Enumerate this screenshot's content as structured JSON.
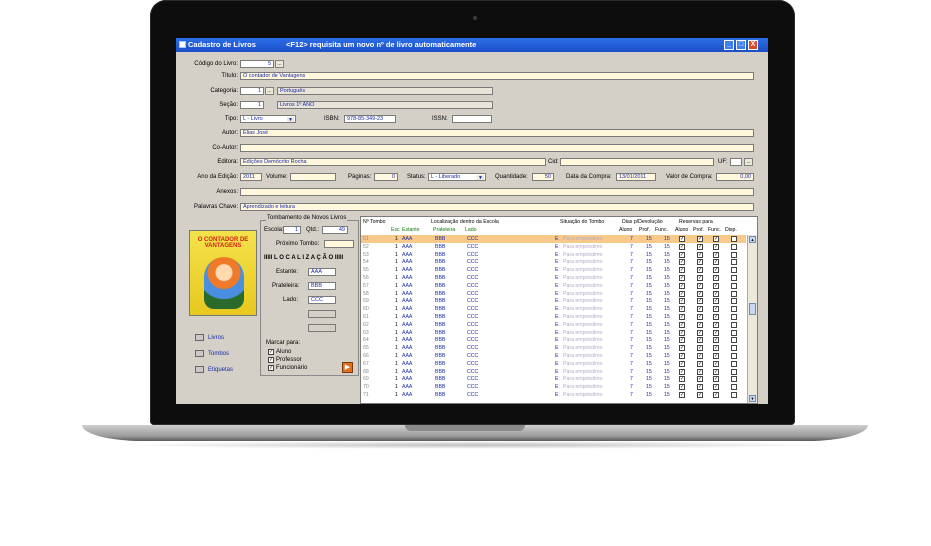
{
  "window": {
    "title": "Cadastro de Livros",
    "subtitle": "<F12> requisita um novo nº de livro automaticamente",
    "min": "_",
    "max": "□",
    "close": "X"
  },
  "form": {
    "codigo_label": "Código do Livro:",
    "codigo_value": "5",
    "codigo_btn": "...",
    "titulo_label": "Título:",
    "titulo_value": "O contador de Vantagens",
    "categoria_label": "Categoria:",
    "categoria_num": "1",
    "categoria_btn": "...",
    "categoria_value": "Português",
    "secao_label": "Seção:",
    "secao_num": "1",
    "secao_value": "Livros 1º ANO",
    "tipo_label": "Tipo:",
    "tipo_value": "L - Livro",
    "isbn_label": "ISBN:",
    "isbn_value": "978-85-349-23",
    "issn_label": "ISSN:",
    "issn_value": "",
    "autor_label": "Autor:",
    "autor_value": "Elias José",
    "coautor_label": "Co-Autor:",
    "coautor_value": "",
    "editora_label": "Editora:",
    "editora_value": "Edições Demócrito Rocha",
    "cid_label": "Cid:",
    "cid_value": "",
    "uf_label": "UF:",
    "uf_value": "",
    "uf_btn": "...",
    "ano_label": "Ano da Edição:",
    "ano_value": "2011",
    "volume_label": "Volume:",
    "volume_value": "",
    "paginas_label": "Páginas:",
    "paginas_value": "0",
    "status_label": "Status:",
    "status_value": "L - Liberado",
    "quantidade_label": "Quantidade:",
    "quantidade_value": "50",
    "data_compra_label": "Data da Compra:",
    "data_compra_value": "13/01/2011",
    "valor_label": "Valor de Compra:",
    "valor_value": "0,00",
    "anexos_label": "Anexos:",
    "anexos_value": "",
    "palavras_label": "Palavras Chave:",
    "palavras_value": "Aprendizado e leitura"
  },
  "cover": {
    "title": "O CONTADOR DE VANTAGENS",
    "author": "Elias José"
  },
  "side_links": [
    "Livros",
    "Tombos",
    "Etiquetas"
  ],
  "tombamento": {
    "title": "Tombamento de Novos Livros",
    "escola_label": "Escola:",
    "escola_value": "1",
    "qtd_label": "Qtd.:",
    "qtd_value": "49",
    "proximo_label": "Próximo Tombo:",
    "proximo_value": "",
    "localizacao_title": "IIIII L O C A L I Z A Ç Ã O IIIII",
    "estante_label": "Estante:",
    "estante_value": "AAA",
    "prateleira_label": "Prateleira:",
    "prateleira_value": "BBB",
    "lado_label": "Lado:",
    "lado_value": "CCC",
    "marcar_title": "Marcar para:",
    "opts": [
      "Aluno",
      "Professor",
      "Funcionário"
    ]
  },
  "grid": {
    "h_tombo": "Nº Tombo",
    "h_loc": "Localização dentro da Escola",
    "h_situacao": "Situação do Tombo",
    "h_dias": "Dias p/Devolução",
    "h_reservas": "Reservas para",
    "sub_esc": "Esc",
    "sub_estante": "Estante",
    "sub_prateleira": "Prateleira",
    "sub_lado": "Lado",
    "sub_aluno": "Aluno",
    "sub_prof": "Prof.",
    "sub_func": "Func.",
    "sub_aluno2": "Aluno",
    "sub_prof2": "Prof.",
    "sub_func2": "Func.",
    "sub_disp": "Disp.",
    "rows": [
      {
        "tombo": "51",
        "esc": "1",
        "estante": "AAA",
        "prat": "BBB",
        "lado": "CCC",
        "sit_code": "E",
        "sit": "Para empréstimo",
        "da": "7",
        "dp": "15",
        "df": "15"
      },
      {
        "tombo": "52",
        "esc": "1",
        "estante": "AAA",
        "prat": "BBB",
        "lado": "CCC",
        "sit_code": "E",
        "sit": "Para empréstimo",
        "da": "7",
        "dp": "15",
        "df": "15"
      },
      {
        "tombo": "53",
        "esc": "1",
        "estante": "AAA",
        "prat": "BBB",
        "lado": "CCC",
        "sit_code": "E",
        "sit": "Para empréstimo",
        "da": "7",
        "dp": "15",
        "df": "15"
      },
      {
        "tombo": "54",
        "esc": "1",
        "estante": "AAA",
        "prat": "BBB",
        "lado": "CCC",
        "sit_code": "E",
        "sit": "Para empréstimo",
        "da": "7",
        "dp": "15",
        "df": "15"
      },
      {
        "tombo": "55",
        "esc": "1",
        "estante": "AAA",
        "prat": "BBB",
        "lado": "CCC",
        "sit_code": "E",
        "sit": "Para empréstimo",
        "da": "7",
        "dp": "15",
        "df": "15"
      },
      {
        "tombo": "56",
        "esc": "1",
        "estante": "AAA",
        "prat": "BBB",
        "lado": "CCC",
        "sit_code": "E",
        "sit": "Para empréstimo",
        "da": "7",
        "dp": "15",
        "df": "15"
      },
      {
        "tombo": "57",
        "esc": "1",
        "estante": "AAA",
        "prat": "BBB",
        "lado": "CCC",
        "sit_code": "E",
        "sit": "Para empréstimo",
        "da": "7",
        "dp": "15",
        "df": "15"
      },
      {
        "tombo": "58",
        "esc": "1",
        "estante": "AAA",
        "prat": "BBB",
        "lado": "CCC",
        "sit_code": "E",
        "sit": "Para empréstimo",
        "da": "7",
        "dp": "15",
        "df": "15"
      },
      {
        "tombo": "59",
        "esc": "1",
        "estante": "AAA",
        "prat": "BBB",
        "lado": "CCC",
        "sit_code": "E",
        "sit": "Para empréstimo",
        "da": "7",
        "dp": "15",
        "df": "15"
      },
      {
        "tombo": "60",
        "esc": "1",
        "estante": "AAA",
        "prat": "BBB",
        "lado": "CCC",
        "sit_code": "E",
        "sit": "Para empréstimo",
        "da": "7",
        "dp": "15",
        "df": "15"
      },
      {
        "tombo": "61",
        "esc": "1",
        "estante": "AAA",
        "prat": "BBB",
        "lado": "CCC",
        "sit_code": "E",
        "sit": "Para empréstimo",
        "da": "7",
        "dp": "15",
        "df": "15"
      },
      {
        "tombo": "62",
        "esc": "1",
        "estante": "AAA",
        "prat": "BBB",
        "lado": "CCC",
        "sit_code": "E",
        "sit": "Para empréstimo",
        "da": "7",
        "dp": "15",
        "df": "15"
      },
      {
        "tombo": "63",
        "esc": "1",
        "estante": "AAA",
        "prat": "BBB",
        "lado": "CCC",
        "sit_code": "E",
        "sit": "Para empréstimo",
        "da": "7",
        "dp": "15",
        "df": "15"
      },
      {
        "tombo": "64",
        "esc": "1",
        "estante": "AAA",
        "prat": "BBB",
        "lado": "CCC",
        "sit_code": "E",
        "sit": "Para empréstimo",
        "da": "7",
        "dp": "15",
        "df": "15"
      },
      {
        "tombo": "65",
        "esc": "1",
        "estante": "AAA",
        "prat": "BBB",
        "lado": "CCC",
        "sit_code": "E",
        "sit": "Para empréstimo",
        "da": "7",
        "dp": "15",
        "df": "15"
      },
      {
        "tombo": "66",
        "esc": "1",
        "estante": "AAA",
        "prat": "BBB",
        "lado": "CCC",
        "sit_code": "E",
        "sit": "Para empréstimo",
        "da": "7",
        "dp": "15",
        "df": "15"
      },
      {
        "tombo": "67",
        "esc": "1",
        "estante": "AAA",
        "prat": "BBB",
        "lado": "CCC",
        "sit_code": "E",
        "sit": "Para empréstimo",
        "da": "7",
        "dp": "15",
        "df": "15"
      },
      {
        "tombo": "68",
        "esc": "1",
        "estante": "AAA",
        "prat": "BBB",
        "lado": "CCC",
        "sit_code": "E",
        "sit": "Para empréstimo",
        "da": "7",
        "dp": "15",
        "df": "15"
      },
      {
        "tombo": "69",
        "esc": "1",
        "estante": "AAA",
        "prat": "BBB",
        "lado": "CCC",
        "sit_code": "E",
        "sit": "Para empréstimo",
        "da": "7",
        "dp": "15",
        "df": "15"
      },
      {
        "tombo": "70",
        "esc": "1",
        "estante": "AAA",
        "prat": "BBB",
        "lado": "CCC",
        "sit_code": "E",
        "sit": "Para empréstimo",
        "da": "7",
        "dp": "15",
        "df": "15"
      },
      {
        "tombo": "71",
        "esc": "1",
        "estante": "AAA",
        "prat": "BBB",
        "lado": "CCC",
        "sit_code": "E",
        "sit": "Para empréstimo",
        "da": "7",
        "dp": "15",
        "df": "15"
      }
    ]
  },
  "colors": {
    "title_bar": "#1b4fc7",
    "field_bg": "#fff8dd",
    "selected_row": "#f7c98a",
    "value_text": "#1a2aa8",
    "header_green": "#0a7a0a"
  }
}
